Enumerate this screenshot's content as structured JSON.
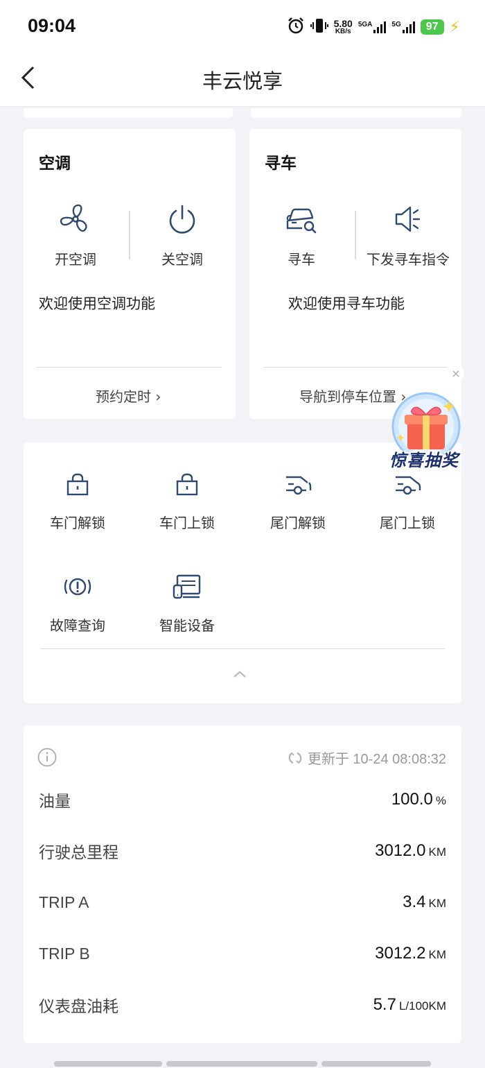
{
  "status_bar": {
    "time": "09:04",
    "speed_value": "5.80",
    "speed_unit": "KB/s",
    "net1_label": "5GA",
    "net2_label": "5G",
    "battery": "97"
  },
  "nav": {
    "title": "丰云悦享",
    "back_icon": "chevron-left-icon"
  },
  "ac_card": {
    "title": "空调",
    "actions": [
      {
        "label": "开空调",
        "icon": "fan-icon"
      },
      {
        "label": "关空调",
        "icon": "power-icon"
      }
    ],
    "welcome": "欢迎使用空调功能",
    "link": "预约定时"
  },
  "find_card": {
    "title": "寻车",
    "actions": [
      {
        "label": "寻车",
        "icon": "car-search-icon"
      },
      {
        "label": "下发寻车指令",
        "icon": "speaker-icon"
      }
    ],
    "welcome": "欢迎使用寻车功能",
    "link": "导航到停车位置"
  },
  "promo": {
    "text": "惊喜抽奖",
    "icon": "gift-box-icon"
  },
  "controls": {
    "items": [
      {
        "label": "车门解锁",
        "icon": "unlock-icon"
      },
      {
        "label": "车门上锁",
        "icon": "lock-icon"
      },
      {
        "label": "尾门解锁",
        "icon": "trunk-unlock-icon"
      },
      {
        "label": "尾门上锁",
        "icon": "trunk-lock-icon"
      },
      {
        "label": "故障查询",
        "icon": "warning-icon"
      },
      {
        "label": "智能设备",
        "icon": "smart-device-icon"
      }
    ],
    "collapse_icon": "chevron-up-icon"
  },
  "vehicle_info": {
    "updated": "更新于 10-24 08:08:32",
    "rows": [
      {
        "label": "油量",
        "value": "100.0",
        "unit": "%"
      },
      {
        "label": "行驶总里程",
        "value": "3012.0",
        "unit": "KM"
      },
      {
        "label": "TRIP A",
        "value": "3.4",
        "unit": "KM"
      },
      {
        "label": "TRIP B",
        "value": "3012.2",
        "unit": "KM"
      },
      {
        "label": "仪表盘油耗",
        "value": "5.7",
        "unit": "L/100KM"
      }
    ]
  },
  "colors": {
    "icon_blue": "#2f4a70",
    "background": "#f2f3f7",
    "card": "#ffffff"
  }
}
